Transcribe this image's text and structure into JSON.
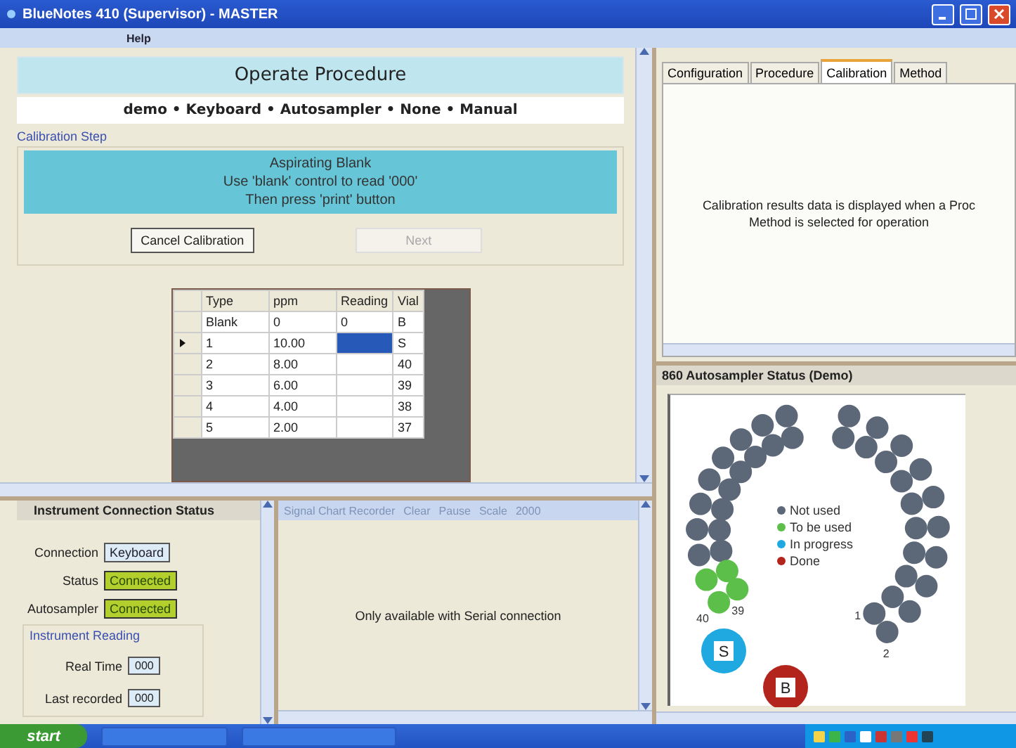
{
  "window": {
    "title": "BlueNotes 410 (Supervisor) - MASTER"
  },
  "menu": [
    {
      "label": "Help",
      "disabled": false
    }
  ],
  "procedure": {
    "title": "Operate Procedure",
    "summary": "demo • Keyboard • Autosampler • None • Manual",
    "step_group": "Calibration Step",
    "instructions": [
      "Aspirating Blank",
      "Use 'blank' control to read '000'",
      "Then press 'print' button"
    ],
    "buttons": [
      {
        "label": "Cancel Calibration",
        "disabled": false
      },
      {
        "label": "Next",
        "disabled": true
      }
    ],
    "table": {
      "columns": [
        "Type",
        "ppm",
        "Reading",
        "Vial"
      ],
      "rows": [
        {
          "cells": [
            "Blank",
            "0",
            "0",
            "B"
          ],
          "selected": false
        },
        {
          "cells": [
            "1",
            "10.00",
            "",
            "S"
          ],
          "selected": true
        },
        {
          "cells": [
            "2",
            "8.00",
            "",
            "40"
          ],
          "selected": false
        },
        {
          "cells": [
            "3",
            "6.00",
            "",
            "39"
          ],
          "selected": false
        },
        {
          "cells": [
            "4",
            "4.00",
            "",
            "38"
          ],
          "selected": false
        },
        {
          "cells": [
            "5",
            "2.00",
            "",
            "37"
          ],
          "selected": false
        }
      ]
    }
  },
  "connection": {
    "title": "Instrument Connection Status",
    "fields": [
      {
        "label": "Connection",
        "value": "Keyboard",
        "kind": "plain"
      },
      {
        "label": "Status",
        "value": "Connected",
        "kind": "ok"
      },
      {
        "label": "Autosampler",
        "value": "Connected",
        "kind": "ok"
      }
    ],
    "reading_group": "Instrument Reading",
    "readings": [
      {
        "label": "Real Time",
        "value": "000"
      },
      {
        "label": "Last recorded",
        "value": "000"
      }
    ]
  },
  "chart_recorder": {
    "toolbar": [
      {
        "label": "Signal Chart Recorder",
        "disabled": true
      },
      {
        "label": "Clear",
        "disabled": true
      },
      {
        "label": "Pause",
        "disabled": true
      },
      {
        "label": "Scale",
        "disabled": true
      },
      {
        "label": "2000",
        "disabled": true
      }
    ],
    "message": "Only available with Serial connection"
  },
  "tabs": [
    {
      "label": "Configuration",
      "selected": false
    },
    {
      "label": "Procedure",
      "selected": false
    },
    {
      "label": "Calibration",
      "selected": true
    },
    {
      "label": "Method",
      "selected": false
    }
  ],
  "calibration_message": [
    "Calibration results data is displayed when a Proc",
    "Method is selected for operation"
  ],
  "autosampler": {
    "title": "860 Autosampler Status (Demo)",
    "legend": [
      {
        "label": "Not used",
        "color": "#5c6778"
      },
      {
        "label": "To be used",
        "color": "#5cbf4a"
      },
      {
        "label": "In progress",
        "color": "#1fa9e0"
      },
      {
        "label": "Done",
        "color": "#b3241c"
      }
    ],
    "vials": [
      {
        "label": "1",
        "color": "#5c6778"
      },
      {
        "label": "2",
        "color": "#5c6778"
      },
      {
        "color": "#5c6778"
      },
      {
        "color": "#5c6778"
      },
      {
        "color": "#5c6778"
      },
      {
        "color": "#5c6778"
      },
      {
        "color": "#5c6778"
      },
      {
        "color": "#5c6778"
      },
      {
        "color": "#5c6778"
      },
      {
        "color": "#5c6778"
      },
      {
        "color": "#5c6778"
      },
      {
        "color": "#5c6778"
      },
      {
        "color": "#5c6778"
      },
      {
        "color": "#5c6778"
      },
      {
        "color": "#5c6778"
      },
      {
        "color": "#5c6778"
      },
      {
        "color": "#5c6778"
      },
      {
        "color": "#5c6778"
      },
      {
        "color": "#5c6778"
      },
      {
        "color": "#5c6778"
      },
      {
        "color": "#5c6778"
      },
      {
        "color": "#5c6778"
      },
      {
        "color": "#5c6778"
      },
      {
        "color": "#5c6778"
      },
      {
        "color": "#5c6778"
      },
      {
        "color": "#5c6778"
      },
      {
        "color": "#5c6778"
      },
      {
        "color": "#5c6778"
      },
      {
        "color": "#5c6778"
      },
      {
        "color": "#5c6778"
      },
      {
        "color": "#5c6778"
      },
      {
        "color": "#5c6778"
      },
      {
        "color": "#5c6778"
      },
      {
        "color": "#5c6778"
      },
      {
        "color": "#5c6778"
      },
      {
        "color": "#5c6778"
      },
      {
        "color": "#5cbf4a"
      },
      {
        "color": "#5cbf4a"
      },
      {
        "label": "39",
        "color": "#5cbf4a"
      },
      {
        "label": "40",
        "color": "#5cbf4a"
      }
    ],
    "standards": [
      {
        "label": "S",
        "color": "#1fa9e0"
      },
      {
        "label": "B",
        "color": "#b3241c"
      }
    ]
  },
  "taskbar": {
    "start": "start"
  }
}
